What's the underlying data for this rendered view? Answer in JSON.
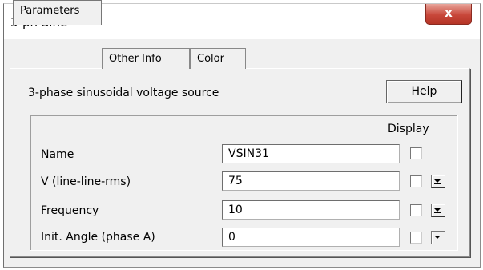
{
  "window": {
    "title": "3-ph Sine",
    "close_label": "x"
  },
  "tabs": [
    {
      "label": "Parameters",
      "active": true
    },
    {
      "label": "Other Info",
      "active": false
    },
    {
      "label": "Color",
      "active": false
    }
  ],
  "description": "3-phase sinusoidal voltage source",
  "help_label": "Help",
  "display_header": "Display",
  "params": [
    {
      "label": "Name",
      "value": "VSIN31",
      "display_checked": false,
      "has_dropdown": false
    },
    {
      "label": "V (line-line-rms)",
      "value": "75",
      "display_checked": false,
      "has_dropdown": true
    },
    {
      "label": "Frequency",
      "value": "10",
      "display_checked": false,
      "has_dropdown": true
    },
    {
      "label": "Init. Angle (phase A)",
      "value": "0",
      "display_checked": false,
      "has_dropdown": true
    }
  ],
  "colors": {
    "close_button": "#c8473a",
    "dialog_background": "#f0f0f0"
  }
}
